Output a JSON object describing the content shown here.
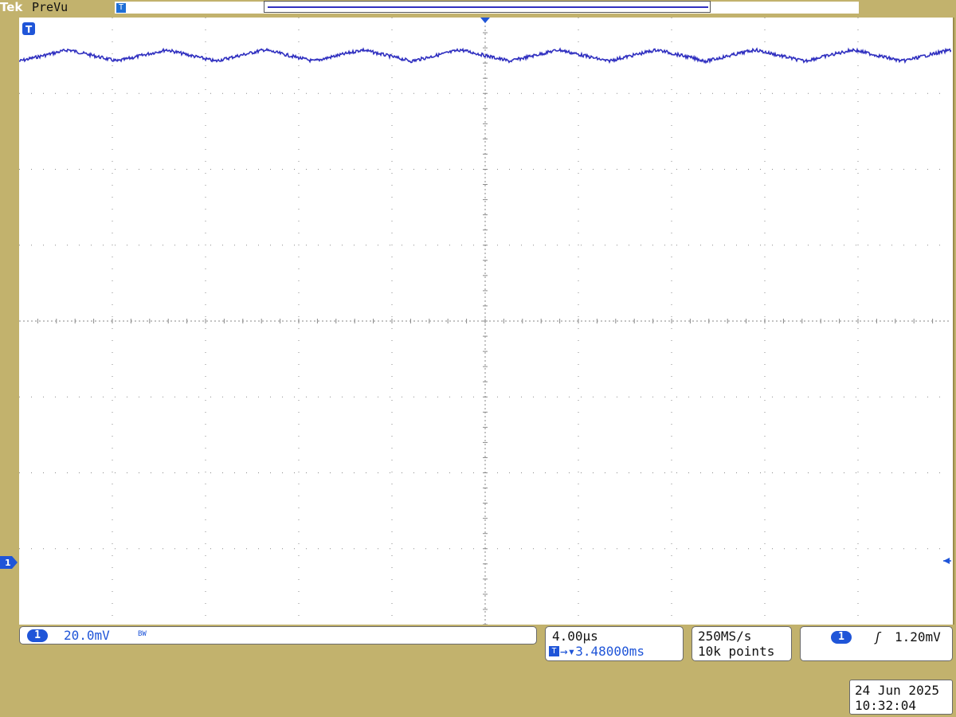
{
  "header": {
    "brand": "Tek",
    "acquisition_state": "PreVu"
  },
  "markers": {
    "trigger_marker_label": "T",
    "channel_ground_label": "1"
  },
  "colors": {
    "background": "#c2b26d",
    "screen": "#ffffff",
    "channel1": "#3030c0",
    "accent": "#1f55d8",
    "grid": "#8a8a8a"
  },
  "channel": {
    "badge": "1",
    "scale": "20.0mV",
    "bandwidth_icon": "BW"
  },
  "timebase": {
    "scale": "4.00µs",
    "delay_icon": "T",
    "delay": "→▾3.48000ms"
  },
  "acquisition": {
    "sample_rate": "250MS/s",
    "record_length": "10k points"
  },
  "trigger": {
    "badge": "1",
    "slope_icon": "rising-edge-icon",
    "slope_glyph": "ʃ",
    "level": "1.20mV"
  },
  "datetime": {
    "date": "24 Jun  2025",
    "time": "10:32:04"
  },
  "chart_data": {
    "type": "line",
    "grid": true,
    "x_divisions": 10,
    "y_divisions": 8,
    "series": [
      {
        "color": "#3030c0",
        "divisions_above_ground": 7.0,
        "ripple_cycles_on_screen": 9.5,
        "ripple_pk_pk_divisions": 0.15
      }
    ]
  }
}
